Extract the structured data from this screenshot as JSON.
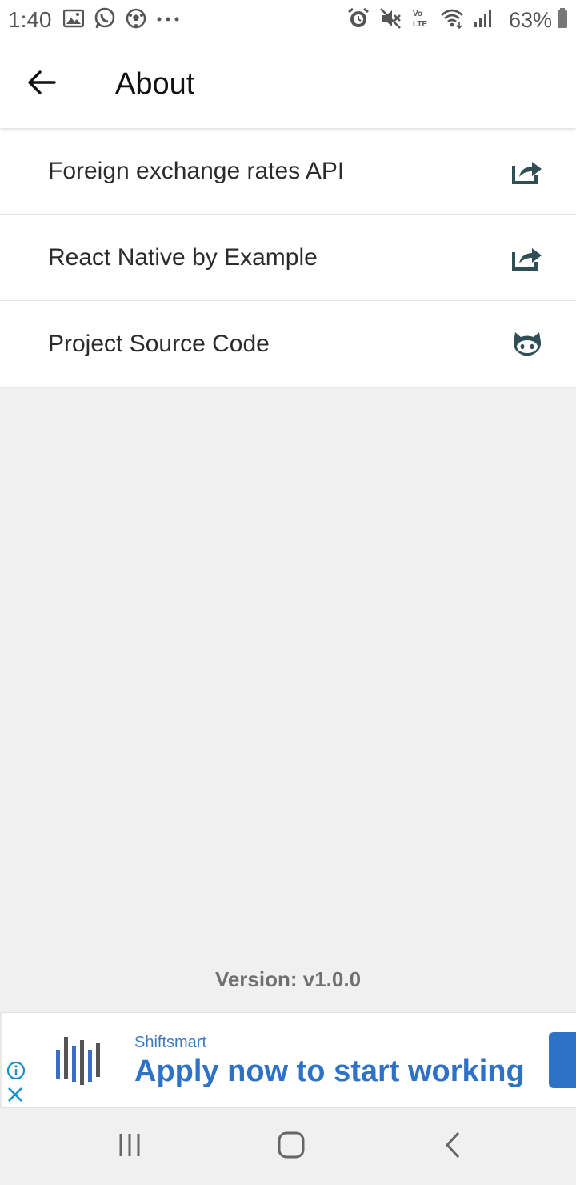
{
  "status_bar": {
    "time": "1:40",
    "battery_percent": "63%",
    "left_icons": [
      "gallery-icon",
      "whatsapp-icon",
      "soccer-ball-icon",
      "more-dots-icon"
    ],
    "right_icons": [
      "alarm-icon",
      "mute-icon",
      "volte-icon",
      "wifi-icon",
      "signal-icon",
      "battery-icon"
    ],
    "volte_label": "Vo\nLTE"
  },
  "header": {
    "title": "About",
    "back_icon": "arrow-left-icon"
  },
  "about_list": {
    "items": [
      {
        "label": "Foreign exchange rates API",
        "icon": "share-external-icon"
      },
      {
        "label": "React Native by Example",
        "icon": "share-external-icon"
      },
      {
        "label": "Project Source Code",
        "icon": "github-icon"
      }
    ]
  },
  "version": {
    "text": "Version: v1.0.0"
  },
  "ad": {
    "advertiser": "Shiftsmart",
    "headline": "Apply now to start working",
    "accent_color": "#2e72c8"
  },
  "colors": {
    "icon_color": "#2f4f55",
    "background": "#f0f0f0"
  }
}
